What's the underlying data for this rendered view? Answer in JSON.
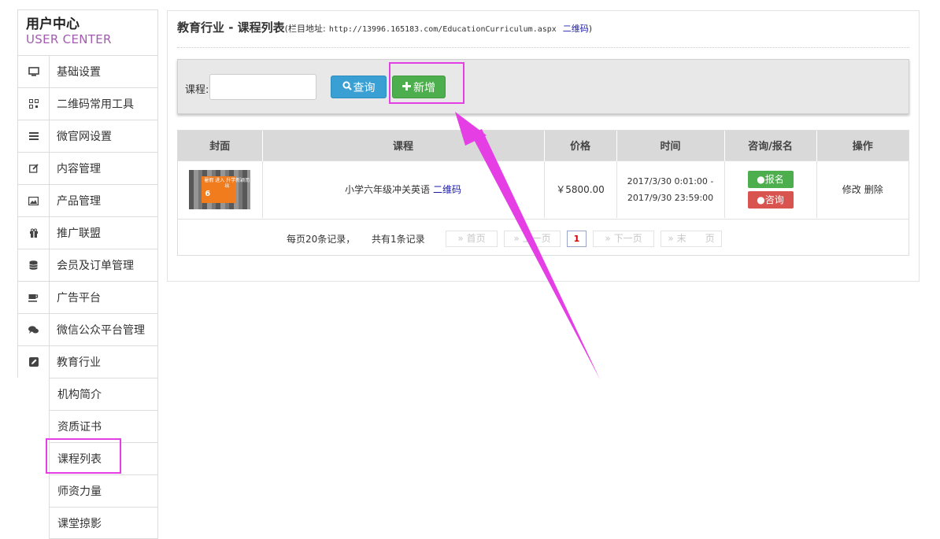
{
  "sidebar": {
    "title": "用户中心",
    "subtitle": "USER CENTER",
    "items": [
      {
        "label": "基础设置",
        "icon": "monitor-icon"
      },
      {
        "label": "二维码常用工具",
        "icon": "qrcode-icon"
      },
      {
        "label": "微官网设置",
        "icon": "list-icon"
      },
      {
        "label": "内容管理",
        "icon": "edit-icon"
      },
      {
        "label": "产品管理",
        "icon": "picture-icon"
      },
      {
        "label": "推广联盟",
        "icon": "gift-icon"
      },
      {
        "label": "会员及订单管理",
        "icon": "database-icon"
      },
      {
        "label": "广告平台",
        "icon": "coffee-icon"
      },
      {
        "label": "微信公众平台管理",
        "icon": "comments-icon"
      },
      {
        "label": "教育行业",
        "icon": "pencil-square-icon"
      }
    ],
    "subitems": [
      "机构简介",
      "资质证书",
      "课程列表",
      "师资力量",
      "课堂掠影"
    ]
  },
  "header": {
    "title": "教育行业 - 课程列表",
    "meta_prefix": "(栏目地址:",
    "url": "http://13996.165183.com/EducationCurriculum.aspx",
    "qr_link": "二维码",
    "meta_suffix": ")"
  },
  "search": {
    "label": "课程:",
    "value": "",
    "query_label": "查询",
    "add_label": "新增"
  },
  "table": {
    "columns": [
      "封面",
      "课程",
      "价格",
      "时间",
      "咨询/报名",
      "操作"
    ],
    "rows": [
      {
        "cover_text_top": "暑假 进入 升学新颖而出",
        "cover_text_big": "6",
        "course": "小学六年级冲关英语",
        "course_link": "二维码",
        "price": "￥5800.00",
        "time_start": "2017/3/30 0:01:00 -",
        "time_end": "2017/9/30 23:59:00",
        "sign_label": "报名",
        "ask_label": "咨询",
        "edit_label": "修改",
        "delete_label": "删除"
      }
    ]
  },
  "pager": {
    "per_page": "每页20条记录，",
    "total": "共有1条记录",
    "first": "» 首页",
    "prev": "» 上一页",
    "current": "1",
    "next": "» 下一页",
    "last": "» 末　　页"
  },
  "colors": {
    "highlight": "#e53ee5",
    "query_button": "#3aa0d3",
    "add_button": "#4cae4c",
    "ask_button": "#d9534f",
    "subtitle": "#a25bb0"
  }
}
